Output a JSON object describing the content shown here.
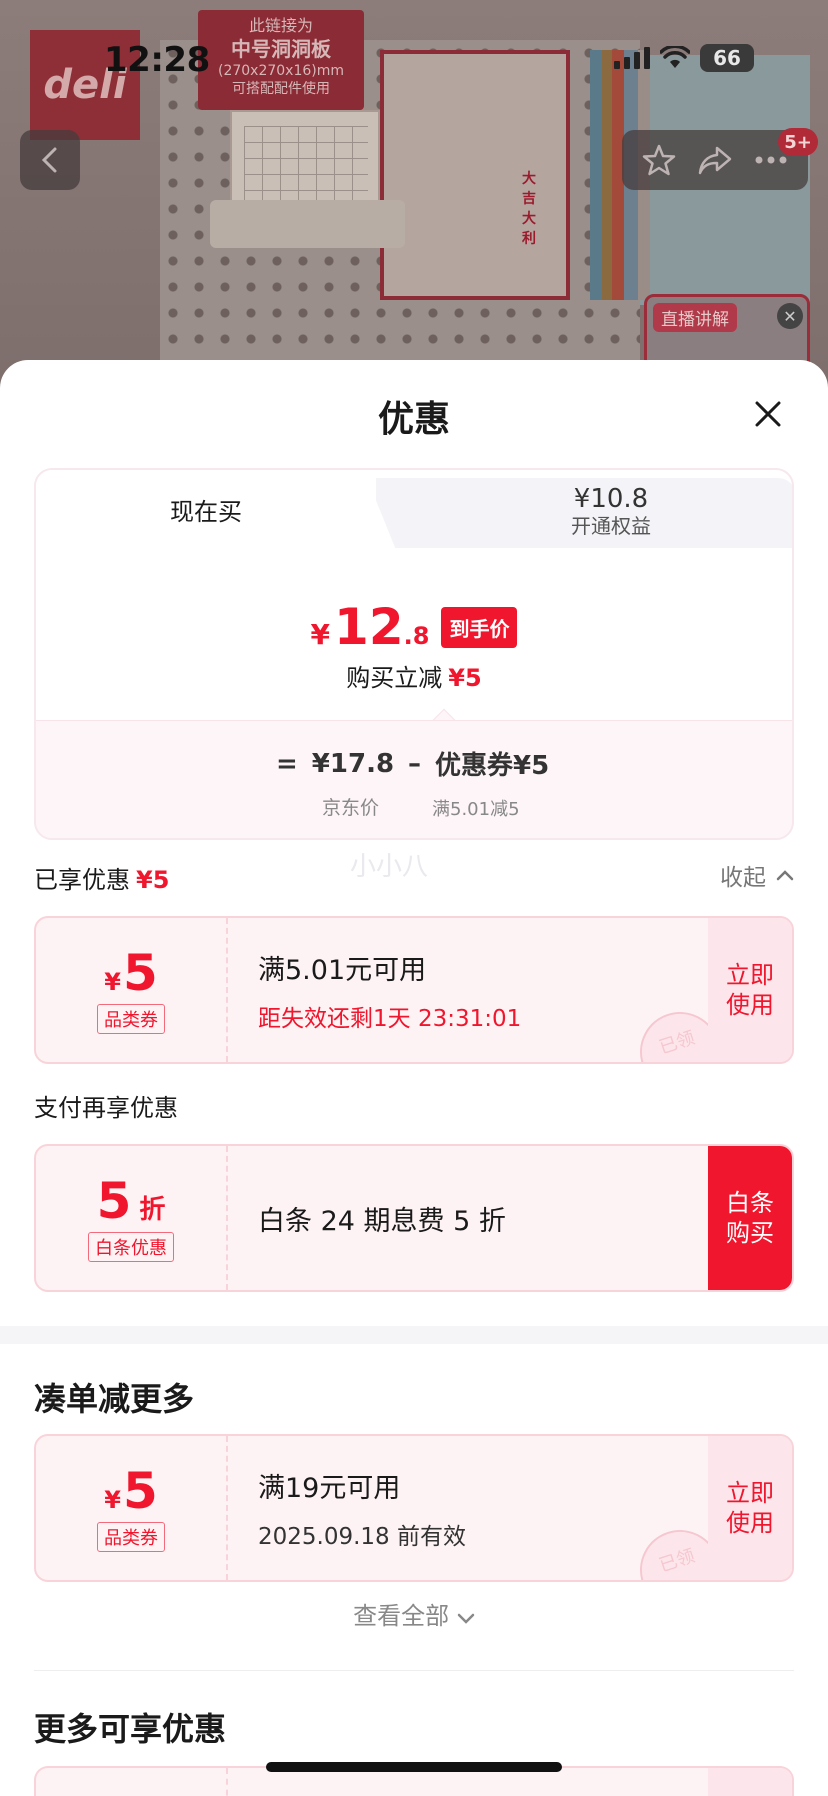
{
  "status": {
    "time": "12:28",
    "battery": "66"
  },
  "product": {
    "brand": "deli",
    "tag_line1": "此链接为",
    "tag_line2": "中号洞洞板",
    "tag_line3": "(270x270x16)mm",
    "tag_line4": "可搭配配件使用",
    "poster_text": "大吉大利",
    "badge": "5+",
    "live_tag": "直播讲解"
  },
  "sheet": {
    "title": "优惠",
    "tab_now": "现在买",
    "tab_member_price": "¥10.8",
    "tab_member_label": "开通权益",
    "final_currency": "¥",
    "final_int": "12",
    "final_dec": ".8",
    "final_tag": "到手价",
    "reduce_label": "购买立减",
    "reduce_amount": "¥5",
    "calc_eq": "=",
    "calc_base": "¥17.8",
    "calc_minus": "–",
    "calc_coupon": "优惠券¥5",
    "calc_base_label": "京东价",
    "calc_coupon_label": "满5.01减5",
    "watermark": "小小八",
    "enjoyed_label": "已享优惠",
    "enjoyed_amount": "¥5",
    "collapse": "收起"
  },
  "coupon1": {
    "currency": "¥",
    "amount": "5",
    "kind": "品类券",
    "title": "满5.01元可用",
    "desc": "距失效还剩1天 23:31:01",
    "action": "立即使用",
    "stamp": "已领"
  },
  "pay_section": "支付再享优惠",
  "coupon2": {
    "amount": "5",
    "unit": "折",
    "kind": "白条优惠",
    "title": "白条 24 期息费 5 折",
    "action": "白条购买"
  },
  "more_section": "凑单减更多",
  "coupon3": {
    "currency": "¥",
    "amount": "5",
    "kind": "品类券",
    "title": "满19元可用",
    "desc": "2025.09.18 前有效",
    "action": "立即使用",
    "stamp": "已领"
  },
  "view_all": "查看全部",
  "more_benefits": "更多可享优惠",
  "colors": {
    "accent": "#f0162d",
    "coupon_bg": "#fdf3f5",
    "coupon_border": "#f9d3da"
  }
}
